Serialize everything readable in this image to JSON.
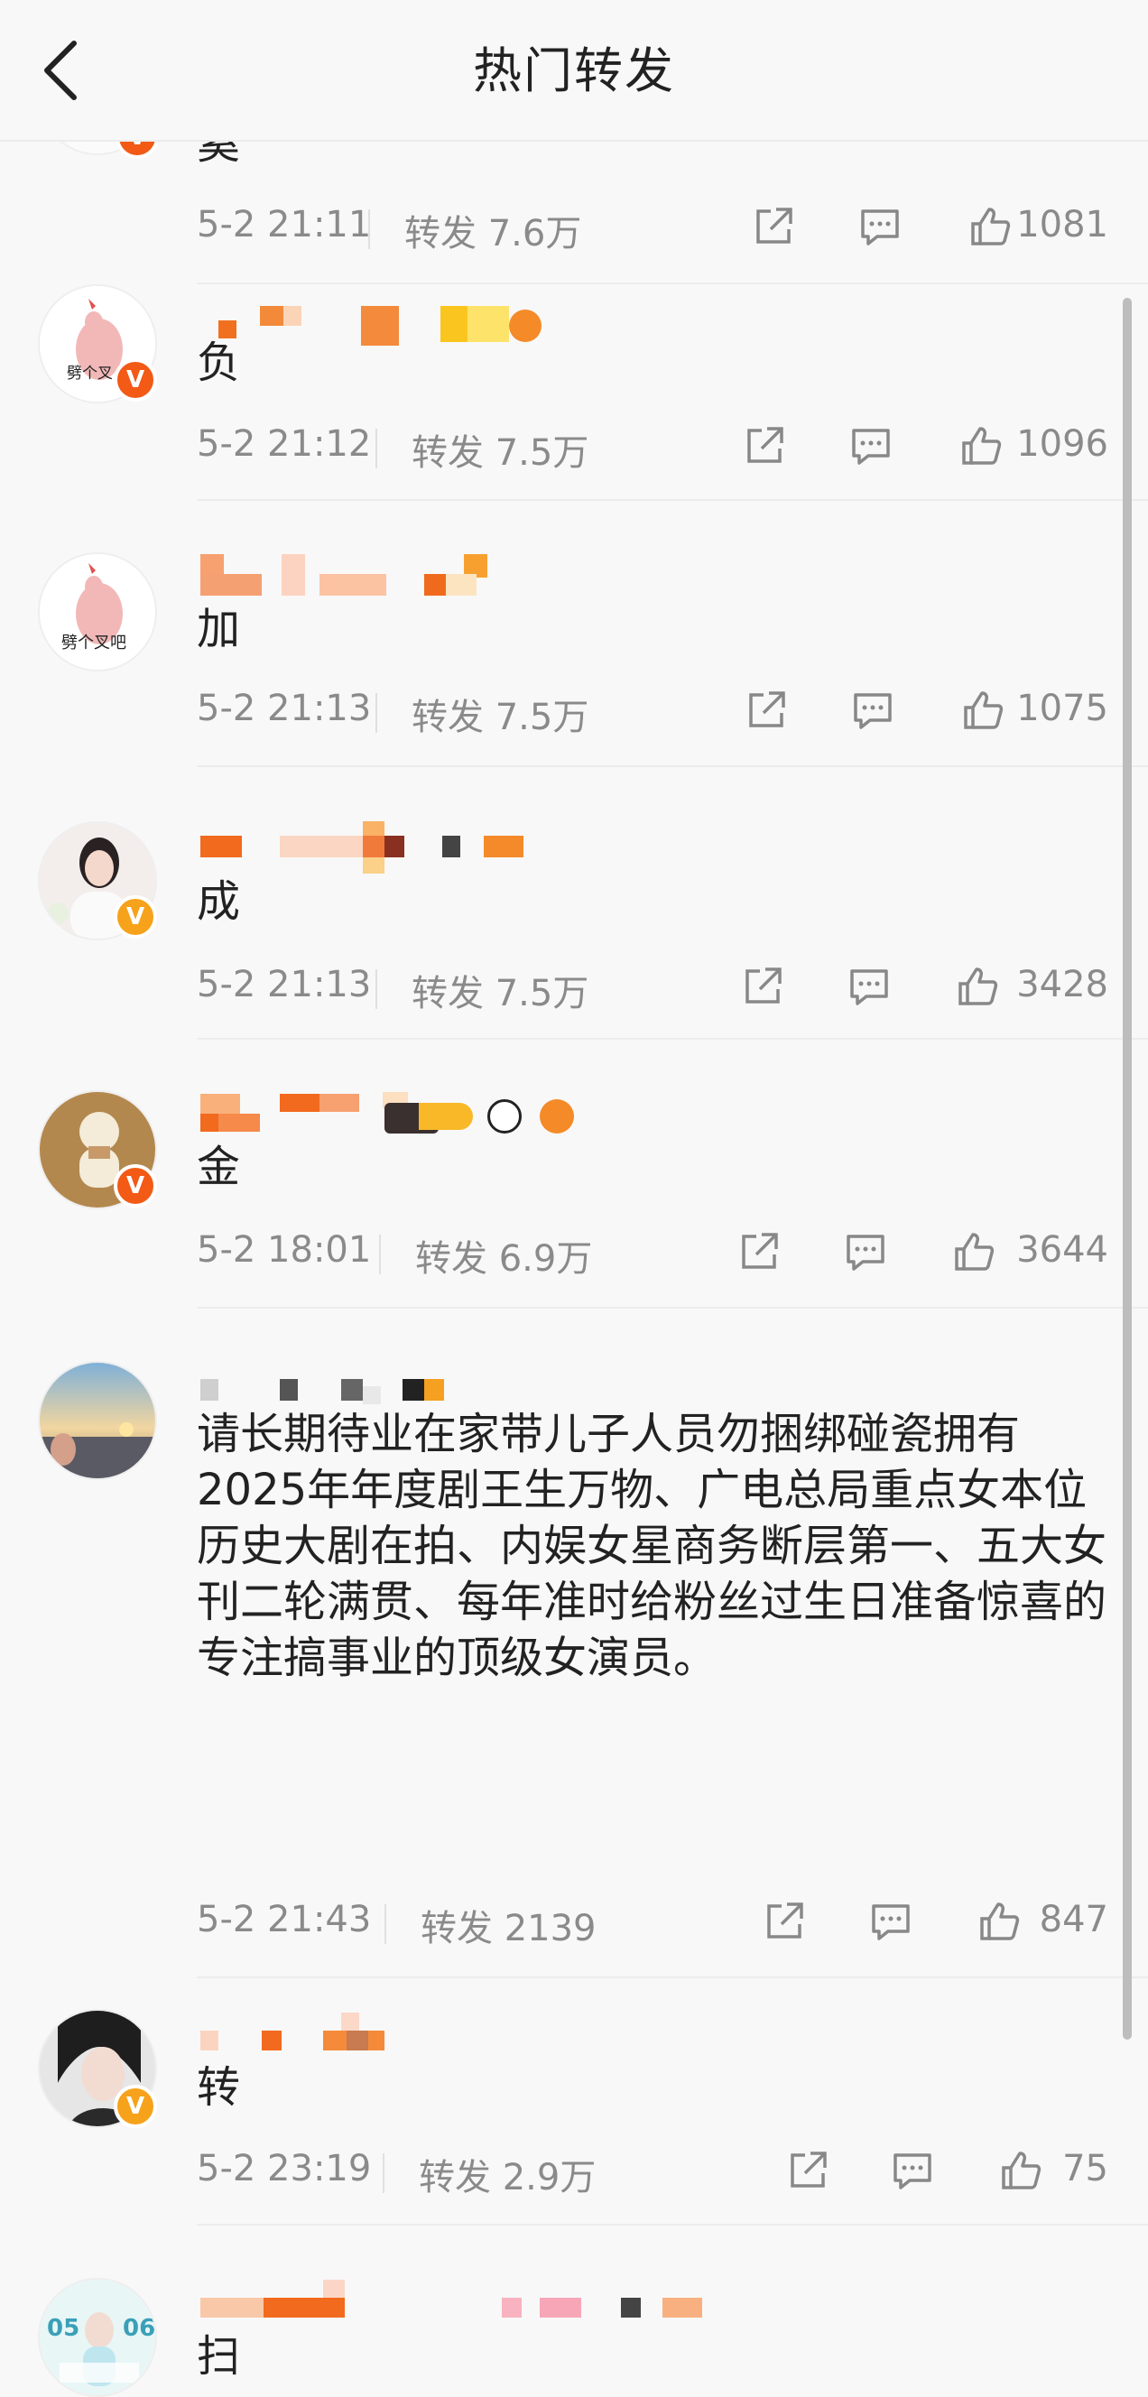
{
  "header": {
    "title": "热门转发"
  },
  "comments": [
    {
      "content": "奚",
      "time": "5-2 21:11",
      "reposts": "转发 7.6万",
      "likes": "1081"
    },
    {
      "content": "负",
      "time": "5-2 21:12",
      "reposts": "转发 7.5万",
      "likes": "1096"
    },
    {
      "content": "加",
      "time": "5-2 21:13",
      "reposts": "转发 7.5万",
      "likes": "1075"
    },
    {
      "content": "成",
      "time": "5-2 21:13",
      "reposts": "转发 7.5万",
      "likes": "3428"
    },
    {
      "content": "金",
      "time": "5-2 18:01",
      "reposts": "转发 6.9万",
      "likes": "3644"
    },
    {
      "content": "请长期待业在家带儿子人员勿捆绑碰瓷拥有2025年年度剧王生万物、广电总局重点女本位历史大剧在拍、内娱女星商务断层第一、五大女刊二轮满贯、每年准时给粉丝过生日准备惊喜的专注搞事业的顶级女演员。",
      "time": "5-2 21:43",
      "reposts": "转发 2139",
      "likes": "847"
    },
    {
      "content": "转",
      "time": "5-2 23:19",
      "reposts": "转发 2.9万",
      "likes": "75"
    },
    {
      "content": "扫",
      "time": "",
      "reposts": "",
      "likes": ""
    }
  ],
  "avatars": [
    "劈个叉吧",
    "劈个叉",
    "劈个叉吧"
  ],
  "badge": "V",
  "colors": {
    "accent": "#f7a21b",
    "badge_red": "#f25a16",
    "text": "#222222",
    "muted": "#8a8a8a"
  },
  "icons": {
    "back": "chevron-left-icon",
    "share": "share-icon",
    "comment": "comment-icon",
    "like": "thumbs-up-icon"
  }
}
